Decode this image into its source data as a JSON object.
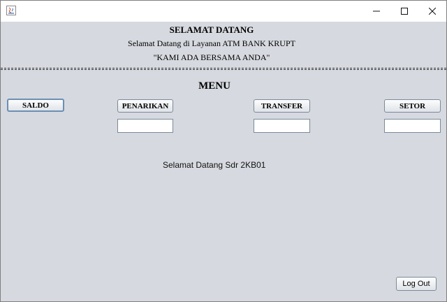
{
  "window": {
    "controls": {
      "minimize_icon": "minimize-icon",
      "maximize_icon": "maximize-icon",
      "close_icon": "close-icon"
    }
  },
  "header": {
    "title": "SELAMAT DATANG",
    "subtitle": "Selamat Datang di Layanan ATM BANK KRUPT",
    "slogan": "\"KAMI ADA BERSAMA ANDA\""
  },
  "menu": {
    "title": "MENU",
    "buttons": {
      "saldo": "SALDO",
      "penarikan": "PENARIKAN",
      "transfer": "TRANSFER",
      "setor": "SETOR"
    },
    "fields": {
      "penarikan_value": "",
      "transfer_value": "",
      "setor_value": ""
    }
  },
  "status": {
    "welcome": "Selamat Datang Sdr 2KB01"
  },
  "footer": {
    "logout_label": "Log Out"
  }
}
